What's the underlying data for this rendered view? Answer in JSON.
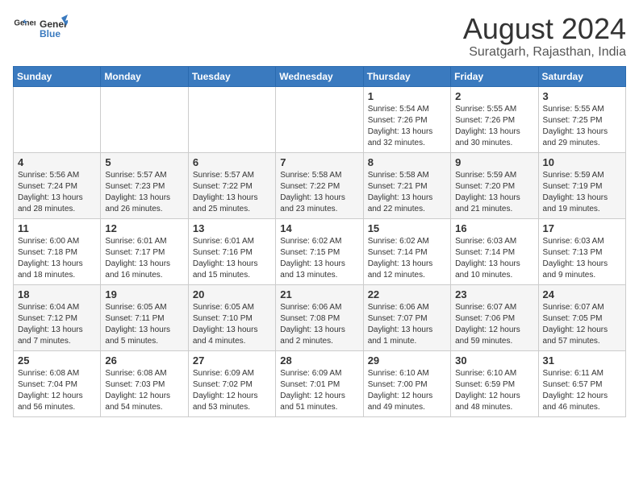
{
  "header": {
    "logo_general": "General",
    "logo_blue": "Blue",
    "title": "August 2024",
    "subtitle": "Suratgarh, Rajasthan, India"
  },
  "days_of_week": [
    "Sunday",
    "Monday",
    "Tuesday",
    "Wednesday",
    "Thursday",
    "Friday",
    "Saturday"
  ],
  "weeks": [
    [
      {
        "day": "",
        "text": ""
      },
      {
        "day": "",
        "text": ""
      },
      {
        "day": "",
        "text": ""
      },
      {
        "day": "",
        "text": ""
      },
      {
        "day": "1",
        "text": "Sunrise: 5:54 AM\nSunset: 7:26 PM\nDaylight: 13 hours\nand 32 minutes."
      },
      {
        "day": "2",
        "text": "Sunrise: 5:55 AM\nSunset: 7:26 PM\nDaylight: 13 hours\nand 30 minutes."
      },
      {
        "day": "3",
        "text": "Sunrise: 5:55 AM\nSunset: 7:25 PM\nDaylight: 13 hours\nand 29 minutes."
      }
    ],
    [
      {
        "day": "4",
        "text": "Sunrise: 5:56 AM\nSunset: 7:24 PM\nDaylight: 13 hours\nand 28 minutes."
      },
      {
        "day": "5",
        "text": "Sunrise: 5:57 AM\nSunset: 7:23 PM\nDaylight: 13 hours\nand 26 minutes."
      },
      {
        "day": "6",
        "text": "Sunrise: 5:57 AM\nSunset: 7:22 PM\nDaylight: 13 hours\nand 25 minutes."
      },
      {
        "day": "7",
        "text": "Sunrise: 5:58 AM\nSunset: 7:22 PM\nDaylight: 13 hours\nand 23 minutes."
      },
      {
        "day": "8",
        "text": "Sunrise: 5:58 AM\nSunset: 7:21 PM\nDaylight: 13 hours\nand 22 minutes."
      },
      {
        "day": "9",
        "text": "Sunrise: 5:59 AM\nSunset: 7:20 PM\nDaylight: 13 hours\nand 21 minutes."
      },
      {
        "day": "10",
        "text": "Sunrise: 5:59 AM\nSunset: 7:19 PM\nDaylight: 13 hours\nand 19 minutes."
      }
    ],
    [
      {
        "day": "11",
        "text": "Sunrise: 6:00 AM\nSunset: 7:18 PM\nDaylight: 13 hours\nand 18 minutes."
      },
      {
        "day": "12",
        "text": "Sunrise: 6:01 AM\nSunset: 7:17 PM\nDaylight: 13 hours\nand 16 minutes."
      },
      {
        "day": "13",
        "text": "Sunrise: 6:01 AM\nSunset: 7:16 PM\nDaylight: 13 hours\nand 15 minutes."
      },
      {
        "day": "14",
        "text": "Sunrise: 6:02 AM\nSunset: 7:15 PM\nDaylight: 13 hours\nand 13 minutes."
      },
      {
        "day": "15",
        "text": "Sunrise: 6:02 AM\nSunset: 7:14 PM\nDaylight: 13 hours\nand 12 minutes."
      },
      {
        "day": "16",
        "text": "Sunrise: 6:03 AM\nSunset: 7:14 PM\nDaylight: 13 hours\nand 10 minutes."
      },
      {
        "day": "17",
        "text": "Sunrise: 6:03 AM\nSunset: 7:13 PM\nDaylight: 13 hours\nand 9 minutes."
      }
    ],
    [
      {
        "day": "18",
        "text": "Sunrise: 6:04 AM\nSunset: 7:12 PM\nDaylight: 13 hours\nand 7 minutes."
      },
      {
        "day": "19",
        "text": "Sunrise: 6:05 AM\nSunset: 7:11 PM\nDaylight: 13 hours\nand 5 minutes."
      },
      {
        "day": "20",
        "text": "Sunrise: 6:05 AM\nSunset: 7:10 PM\nDaylight: 13 hours\nand 4 minutes."
      },
      {
        "day": "21",
        "text": "Sunrise: 6:06 AM\nSunset: 7:08 PM\nDaylight: 13 hours\nand 2 minutes."
      },
      {
        "day": "22",
        "text": "Sunrise: 6:06 AM\nSunset: 7:07 PM\nDaylight: 13 hours\nand 1 minute."
      },
      {
        "day": "23",
        "text": "Sunrise: 6:07 AM\nSunset: 7:06 PM\nDaylight: 12 hours\nand 59 minutes."
      },
      {
        "day": "24",
        "text": "Sunrise: 6:07 AM\nSunset: 7:05 PM\nDaylight: 12 hours\nand 57 minutes."
      }
    ],
    [
      {
        "day": "25",
        "text": "Sunrise: 6:08 AM\nSunset: 7:04 PM\nDaylight: 12 hours\nand 56 minutes."
      },
      {
        "day": "26",
        "text": "Sunrise: 6:08 AM\nSunset: 7:03 PM\nDaylight: 12 hours\nand 54 minutes."
      },
      {
        "day": "27",
        "text": "Sunrise: 6:09 AM\nSunset: 7:02 PM\nDaylight: 12 hours\nand 53 minutes."
      },
      {
        "day": "28",
        "text": "Sunrise: 6:09 AM\nSunset: 7:01 PM\nDaylight: 12 hours\nand 51 minutes."
      },
      {
        "day": "29",
        "text": "Sunrise: 6:10 AM\nSunset: 7:00 PM\nDaylight: 12 hours\nand 49 minutes."
      },
      {
        "day": "30",
        "text": "Sunrise: 6:10 AM\nSunset: 6:59 PM\nDaylight: 12 hours\nand 48 minutes."
      },
      {
        "day": "31",
        "text": "Sunrise: 6:11 AM\nSunset: 6:57 PM\nDaylight: 12 hours\nand 46 minutes."
      }
    ]
  ]
}
